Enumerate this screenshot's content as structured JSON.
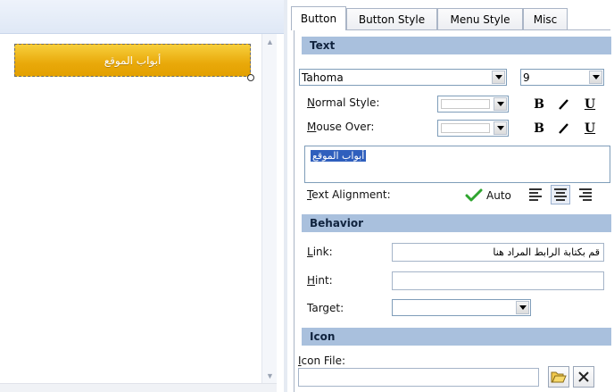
{
  "preview": {
    "button_text": "أبواب الموقع"
  },
  "tabs": [
    {
      "label": "Button",
      "active": true
    },
    {
      "label": "Button Style",
      "active": false
    },
    {
      "label": "Menu Style",
      "active": false
    },
    {
      "label": "Misc",
      "active": false
    }
  ],
  "text_section": {
    "header": "Text",
    "font_family": "Tahoma",
    "font_size": "9",
    "normal_style_label": "ormal Style:",
    "normal_style_accel": "N",
    "mouse_over_label": "ouse Over:",
    "mouse_over_accel": "M",
    "bold_label": "B",
    "italic_label": "/",
    "underline_label": "U",
    "text_value": "أبواب الموقع",
    "alignment_label": "ext Alignment:",
    "alignment_accel": "T",
    "auto_label": "Auto",
    "alignment_selected": "center"
  },
  "behavior_section": {
    "header": "Behavior",
    "link_label": "ink:",
    "link_accel": "L",
    "link_value": "قم بكتابة الرابط المراد هنا",
    "hint_label": "int:",
    "hint_accel": "H",
    "hint_value": "",
    "target_label": "Target:",
    "target_value": ""
  },
  "icon_section": {
    "header": "Icon",
    "icon_file_label": "con File:",
    "icon_file_accel": "I",
    "icon_file_value": ""
  },
  "colors": {
    "section_header_bg": "#a9c0dd",
    "preview_button": "#e9a90a",
    "selection": "#2f5fbd",
    "auto_check": "#2fa52f"
  },
  "icons": [
    "scroll-up-icon",
    "scroll-down-icon",
    "bold-icon",
    "italic-icon",
    "underline-icon",
    "checkmark-icon",
    "align-left-icon",
    "align-center-icon",
    "align-right-icon",
    "folder-open-icon",
    "close-icon"
  ]
}
